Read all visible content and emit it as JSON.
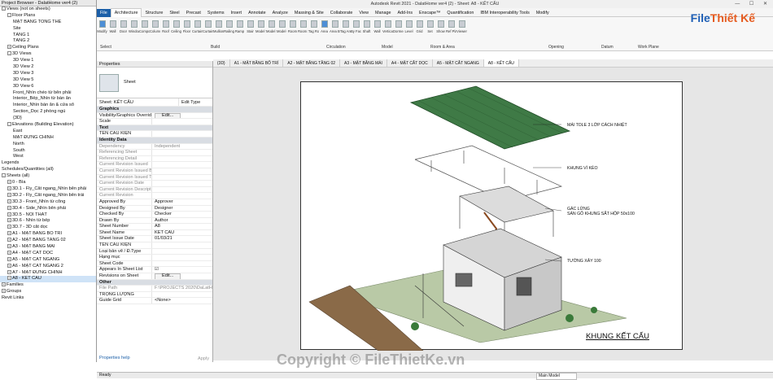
{
  "browser": {
    "title": "Project Browser - DalatHome ver4 (2)",
    "items": [
      {
        "t": "Views (not on sheets)",
        "d": 0,
        "tg": "-"
      },
      {
        "t": "Floor Plans",
        "d": 1,
        "tg": "-"
      },
      {
        "t": "MẶT BẰNG TỔNG THỂ",
        "d": 2
      },
      {
        "t": "Site",
        "d": 2
      },
      {
        "t": "TẦNG 1",
        "d": 2
      },
      {
        "t": "TẦNG 2",
        "d": 2
      },
      {
        "t": "Ceiling Plans",
        "d": 1,
        "tg": "+"
      },
      {
        "t": "3D Views",
        "d": 1,
        "tg": "-"
      },
      {
        "t": "3D View 1",
        "d": 2
      },
      {
        "t": "3D View 2",
        "d": 2
      },
      {
        "t": "3D View 3",
        "d": 2
      },
      {
        "t": "3D View 5",
        "d": 2
      },
      {
        "t": "3D View 6",
        "d": 2
      },
      {
        "t": "Front_Nhìn chéo từ bên phải",
        "d": 2
      },
      {
        "t": "Interior_Bếp_Nhìn từ bàn ăn",
        "d": 2
      },
      {
        "t": "Interior_Nhìn bàn ăn & cửa sổ",
        "d": 2
      },
      {
        "t": "Section_Dọc 2 phòng ngủ",
        "d": 2
      },
      {
        "t": "{3D}",
        "d": 2
      },
      {
        "t": "Elevations (Building Elevation)",
        "d": 1,
        "tg": "-"
      },
      {
        "t": "East",
        "d": 2
      },
      {
        "t": "MẶT ĐỨNG CHÍNH",
        "d": 2
      },
      {
        "t": "North",
        "d": 2
      },
      {
        "t": "South",
        "d": 2
      },
      {
        "t": "West",
        "d": 2
      },
      {
        "t": "Legends",
        "d": 0
      },
      {
        "t": "Schedules/Quantities (all)",
        "d": 0
      },
      {
        "t": "Sheets (all)",
        "d": 0,
        "tg": "-"
      },
      {
        "t": "0 - Bìa",
        "d": 1,
        "tg": "+"
      },
      {
        "t": "3D.1 - Fly_Cắt ngang_Nhìn bên phải",
        "d": 1,
        "tg": "+"
      },
      {
        "t": "3D.2 - Fly_Cắt ngang_Nhìn bên trái",
        "d": 1,
        "tg": "+"
      },
      {
        "t": "3D.3 - Front_Nhìn từ cổng",
        "d": 1,
        "tg": "+"
      },
      {
        "t": "3D.4 - Side_Nhìn bên phải",
        "d": 1,
        "tg": "+"
      },
      {
        "t": "3D.5 - NỘI THẤT",
        "d": 1,
        "tg": "+"
      },
      {
        "t": "3D.6 - Nhìn từ bếp",
        "d": 1,
        "tg": "+"
      },
      {
        "t": "3D.7 - 3D cắt dọc",
        "d": 1,
        "tg": "+"
      },
      {
        "t": "A1 - MẶT BẰNG BỐ TRÍ",
        "d": 1,
        "tg": "+"
      },
      {
        "t": "A2 - MẶT BẰNG TẦNG 02",
        "d": 1,
        "tg": "+"
      },
      {
        "t": "A3 - MẶT BẰNG MÁI",
        "d": 1,
        "tg": "+"
      },
      {
        "t": "A4 - MẶT CẮT DỌC",
        "d": 1,
        "tg": "+"
      },
      {
        "t": "A5 - MẶT CẮT NGANG",
        "d": 1,
        "tg": "+"
      },
      {
        "t": "A6 - MẶT CẮT NGANG 2",
        "d": 1,
        "tg": "+"
      },
      {
        "t": "A7 - MẶT ĐỨNG CHÍNH",
        "d": 1,
        "tg": "+"
      },
      {
        "t": "A8 - KẾT CẤU",
        "d": 1,
        "tg": "+",
        "sel": true
      },
      {
        "t": "Families",
        "d": 0,
        "tg": "+"
      },
      {
        "t": "Groups",
        "d": 0,
        "tg": "+"
      },
      {
        "t": "Revit Links",
        "d": 0
      }
    ]
  },
  "window": {
    "title": "Autodesk Revit 2021 - DalatHome ver4 (2) - Sheet: A8 - KẾT CẤU"
  },
  "ribbon_tabs": [
    "File",
    "Architecture",
    "Structure",
    "Steel",
    "Precast",
    "Systems",
    "Insert",
    "Annotate",
    "Analyze",
    "Massing & Site",
    "Collaborate",
    "View",
    "Manage",
    "Add-Ins",
    "Enscape™",
    "Quantification",
    "IBM Interoperability Tools",
    "Modify"
  ],
  "ribbon": {
    "tools": [
      "Modify",
      "Wall",
      "Door",
      "Window",
      "Component",
      "Column",
      "Roof",
      "Ceiling",
      "Floor",
      "Curtain System",
      "Curtain Grid",
      "Mullion",
      "Railing",
      "Ramp",
      "Stair",
      "Model Text",
      "Model Line",
      "Model Group",
      "Room",
      "Room Separator",
      "Tag Room",
      "Area",
      "Area Boundary",
      "Tag Area",
      "By Face",
      "Shaft",
      "Wall",
      "Vertical",
      "Dormer",
      "Level",
      "Grid",
      "Set",
      "Show",
      "Ref Plane",
      "Viewer"
    ],
    "panels": [
      "Select",
      "Build",
      "Circulation",
      "Model",
      "Room & Area",
      "Opening",
      "Datum",
      "Work Plane"
    ]
  },
  "logo": {
    "a": "File",
    "b": "Thiết Kế",
    ".vn": ".vn"
  },
  "props": {
    "title": "Properties",
    "type": "Sheet",
    "filter": "Sheet: KẾT CẤU",
    "edit_type": "Edit Type",
    "rows": [
      {
        "k": "Graphics",
        "grp": true
      },
      {
        "k": "Visibility/Graphics Overrid...",
        "v": "Edit..."
      },
      {
        "k": "Scale",
        "v": ""
      },
      {
        "k": "Text",
        "grp": true
      },
      {
        "k": "TÊN CẤU KIỆN",
        "v": ""
      },
      {
        "k": "Identity Data",
        "grp": true
      },
      {
        "k": "Dependency",
        "v": "Independent",
        "dis": true
      },
      {
        "k": "Referencing Sheet",
        "v": "",
        "dis": true
      },
      {
        "k": "Referencing Detail",
        "v": "",
        "dis": true
      },
      {
        "k": "Current Revision Issued",
        "v": "",
        "dis": true
      },
      {
        "k": "Current Revision Issued By",
        "v": "",
        "dis": true
      },
      {
        "k": "Current Revision Issued To",
        "v": "",
        "dis": true
      },
      {
        "k": "Current Revision Date",
        "v": "",
        "dis": true
      },
      {
        "k": "Current Revision Descripti...",
        "v": "",
        "dis": true
      },
      {
        "k": "Current Revision",
        "v": "",
        "dis": true
      },
      {
        "k": "Approved By",
        "v": "Approver"
      },
      {
        "k": "Designed By",
        "v": "Designer"
      },
      {
        "k": "Checked By",
        "v": "Checker"
      },
      {
        "k": "Drawn By",
        "v": "Author"
      },
      {
        "k": "Sheet Number",
        "v": "A8"
      },
      {
        "k": "Sheet Name",
        "v": "KẾT CẤU"
      },
      {
        "k": "Sheet Issue Date",
        "v": "01/03/21"
      },
      {
        "k": "TÊN CẤU KIỆN",
        "v": ""
      },
      {
        "k": "Loại bản vẽ / Đ.Type",
        "v": ""
      },
      {
        "k": "Hạng mục",
        "v": ""
      },
      {
        "k": "Sheet Code",
        "v": ""
      },
      {
        "k": "Appears In Sheet List",
        "v": "☑"
      },
      {
        "k": "Revisions on Sheet",
        "v": "Edit..."
      },
      {
        "k": "Other",
        "grp": true
      },
      {
        "k": "File Path",
        "v": "F:\\PROJECTS 2020\\DaLatHom...",
        "dis": true
      },
      {
        "k": "TRỌNG LƯỢNG",
        "v": ""
      },
      {
        "k": "Guide Grid",
        "v": "<None>"
      }
    ],
    "help": "Properties help",
    "apply": "Apply"
  },
  "view_tabs": [
    "{3D}",
    "A1 - MẶT BẰNG BỐ TRÍ",
    "A2 - MẶT BẰNG TẦNG 02",
    "A3 - MẶT BẰNG MÁI",
    "A4 - MẶT CẮT DỌC",
    "A5 - MẶT CẮT NGANG",
    "A8 - KẾT CẤU"
  ],
  "sheet": {
    "labels": [
      "MÁI TOLE 3 LỚP CÁCH NHIỆT",
      "KHUNG VÌ KÈO",
      "GÁC LỬNG\nSÀN GỖ KHUNG SẮT HỘP 50x100",
      "TƯỜNG XÂY 100"
    ],
    "title": "KHUNG KẾT CẤU"
  },
  "status": {
    "left": "Ready",
    "model": "Main Model"
  },
  "watermark": "Copyright © FileThietKe.vn"
}
